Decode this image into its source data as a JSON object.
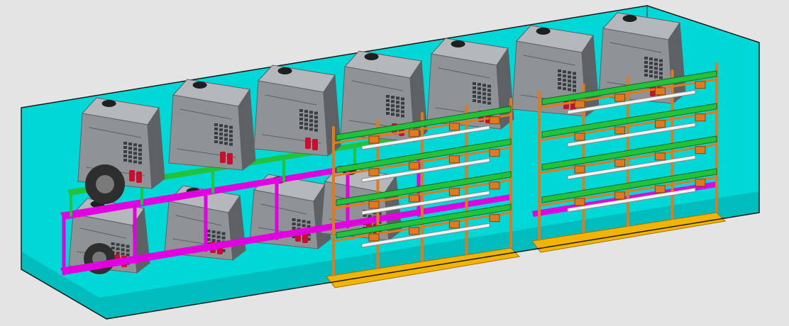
{
  "viewport": {
    "background": "#e4e4e4"
  },
  "model": {
    "colors": {
      "container_wall": "#00d8d8",
      "container_floor": "#00bcbc",
      "container_edge": "#1a1a1a",
      "housing": "#8f9395",
      "housing_light": "#b4b8ba",
      "housing_dark": "#5d6163",
      "vent": "#3a3d3f",
      "rack_magenta": "#e000e0",
      "rack_green": "#22c23a",
      "rack_orange": "#e07a1e",
      "base_yellow": "#f2b400",
      "rail_white": "#f2f2f2",
      "valve_red": "#c8102e",
      "wheel": "#2e2e2e"
    },
    "upper_units": 7,
    "lower_units": 4,
    "racks": 2
  }
}
